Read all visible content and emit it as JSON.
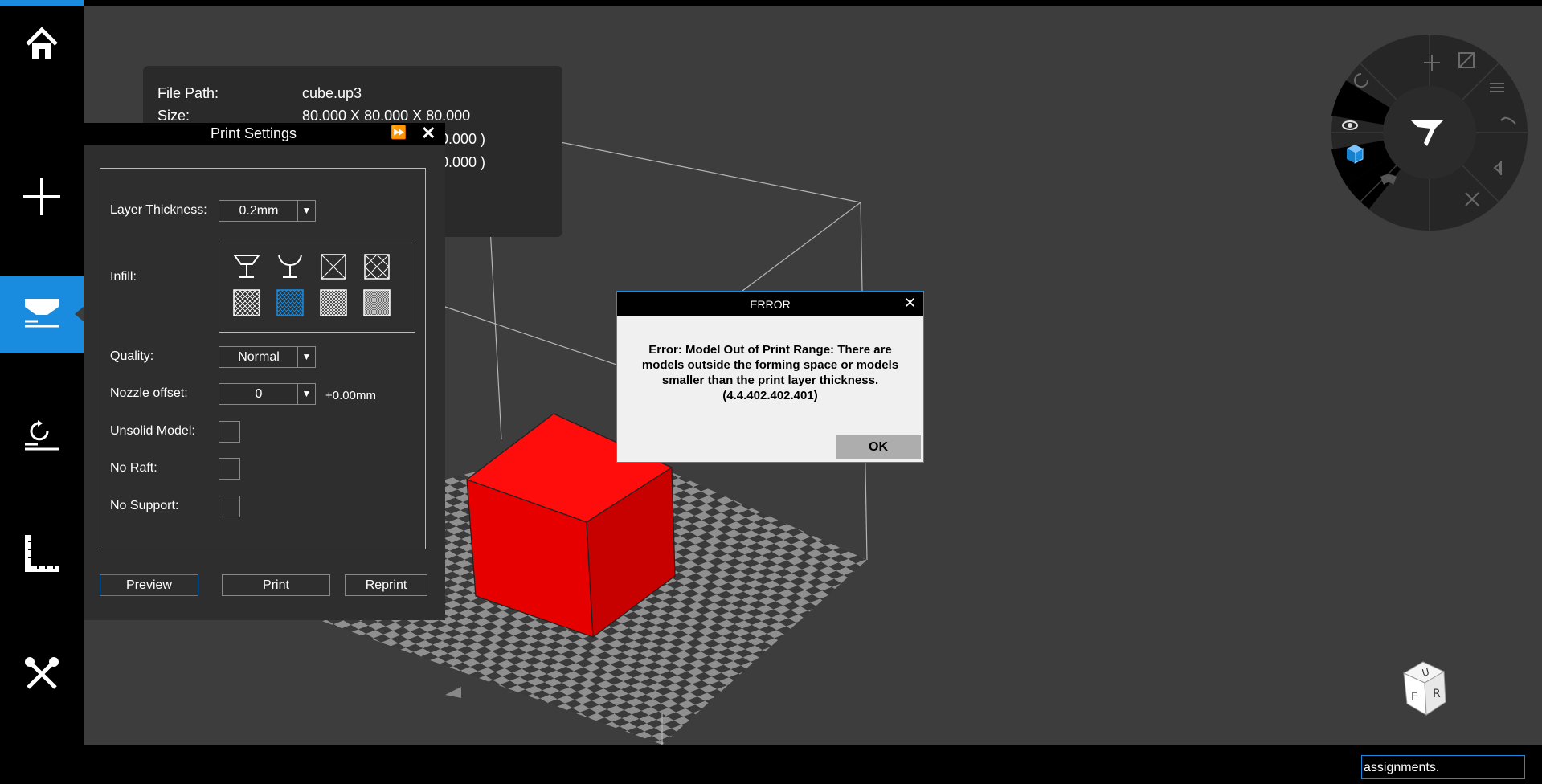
{
  "colors": {
    "accent": "#1a8cdf",
    "model": "#e60000",
    "panel": "#2e2e2e",
    "dialog_bg": "#f0f0f0"
  },
  "sidebar": {
    "items": [
      {
        "name": "home",
        "icon": "home-icon"
      },
      {
        "name": "add",
        "icon": "plus-icon"
      },
      {
        "name": "print",
        "icon": "print-icon",
        "active": true
      },
      {
        "name": "calibrate",
        "icon": "calibrate-icon"
      },
      {
        "name": "measure",
        "icon": "ruler-icon"
      },
      {
        "name": "maintenance",
        "icon": "tools-icon"
      }
    ]
  },
  "info": {
    "file_path_label": "File Path:",
    "file_path_value": "cube.up3",
    "size_label": "Size:",
    "size_value": "80.000 X 80.000 X 80.000",
    "row3_value": "0.000 )",
    "row4_value": "0.000 )"
  },
  "print_settings": {
    "title": "Print Settings",
    "layer_thickness_label": "Layer Thickness:",
    "layer_thickness_value": "0.2mm",
    "infill_label": "Infill:",
    "quality_label": "Quality:",
    "quality_value": "Normal",
    "nozzle_offset_label": "Nozzle offset:",
    "nozzle_offset_value": "0",
    "nozzle_offset_suffix": "+0.00mm",
    "unsolid_label": "Unsolid Model:",
    "no_raft_label": "No Raft:",
    "no_support_label": "No Support:",
    "preview_label": "Preview",
    "print_label": "Print",
    "reprint_label": "Reprint",
    "selected_infill_index": 5
  },
  "error_dialog": {
    "title": "ERROR",
    "message": "Error: Model Out of Print Range: There are models outside the forming space or models smaller than the print layer thickness. (4.4.402.402.401)",
    "ok_label": "OK"
  },
  "viewcube": {
    "face_u": "U",
    "face_f": "F",
    "face_r": "R"
  },
  "status": {
    "input_value": "assignments."
  }
}
